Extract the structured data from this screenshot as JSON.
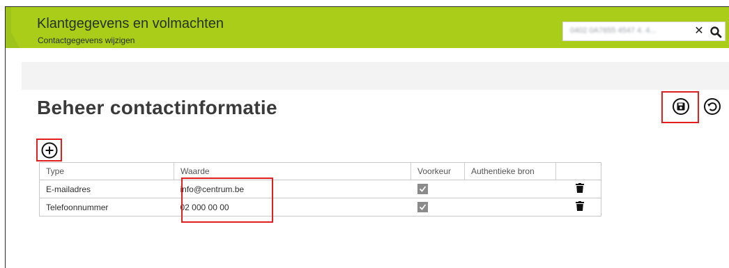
{
  "header": {
    "title": "Klantgegevens en volmachten",
    "subtitle": "Contactgegevens wijzigen"
  },
  "search": {
    "value": "0402 0A7655 4547 4.  4...",
    "clear_icon": "close-icon",
    "search_icon": "search-icon"
  },
  "page": {
    "title": "Beheer contactinformatie"
  },
  "actions": {
    "save_icon": "save-icon",
    "undo_icon": "undo-icon",
    "add_icon": "add-circle-icon"
  },
  "table": {
    "columns": [
      "Type",
      "Waarde",
      "Voorkeur",
      "Authentieke bron",
      ""
    ],
    "rows": [
      {
        "type": "E-mailadres",
        "value": "info@centrum.be",
        "preferred": true,
        "authentic_source": "",
        "delete_icon": "trash-icon"
      },
      {
        "type": "Telefoonnummer",
        "value": "02 000 00 00",
        "preferred": true,
        "authentic_source": "",
        "delete_icon": "trash-icon"
      }
    ]
  },
  "colors": {
    "header_green": "#a9cd19",
    "highlight_red": "#e0201e",
    "content_bg": "#f3f3f3"
  }
}
